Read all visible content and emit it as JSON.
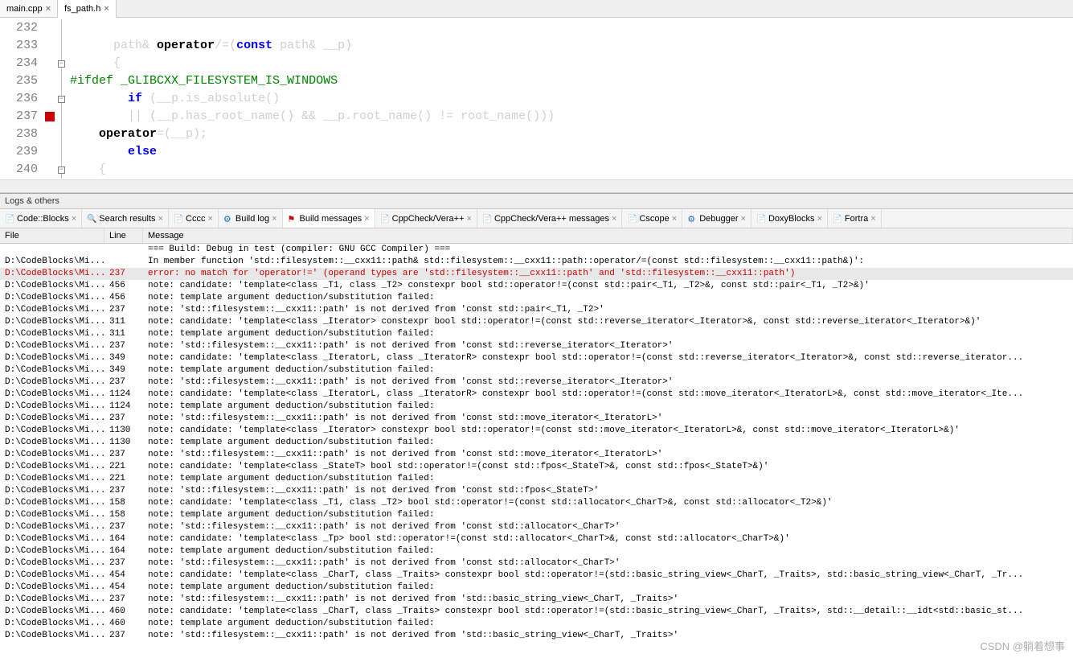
{
  "file_tabs": [
    {
      "label": "main.cpp",
      "active": false
    },
    {
      "label": "fs_path.h",
      "active": true
    }
  ],
  "code": {
    "lines": [
      {
        "n": 232,
        "fold": "line",
        "html": ""
      },
      {
        "n": 233,
        "fold": "line",
        "html": "      <span class='fade'>path&amp; </span><span class='bold'>operator</span><span class='fade'>/=(</span><span class='kw'>const</span><span class='fade'> path&amp; __p)</span>"
      },
      {
        "n": 234,
        "fold": "box-",
        "html": "      <span class='fade'>{</span>"
      },
      {
        "n": 235,
        "fold": "line",
        "html": "<span class='pp'>#ifdef _GLIBCXX_FILESYSTEM_IS_WINDOWS</span>"
      },
      {
        "n": 236,
        "fold": "box-",
        "html": "        <span class='kw'>if</span> <span class='fade'>(__p.is_absolute()</span>"
      },
      {
        "n": 237,
        "fold": "line",
        "mark": "red",
        "html": "        <span class='fade'>|| (__p.has_root_name() &amp;&amp; __p.root_name() != root_name()))</span>"
      },
      {
        "n": 238,
        "fold": "line",
        "html": "    <span class='bold'>operator</span><span class='fade'>=(__p);</span>"
      },
      {
        "n": 239,
        "fold": "line",
        "html": "        <span class='kw'>else</span>"
      },
      {
        "n": 240,
        "fold": "box-",
        "html": "    <span class='fade'>{</span>"
      }
    ]
  },
  "logs_header": "Logs & others",
  "panel_tabs": [
    {
      "icon": "note",
      "label": "Code::Blocks"
    },
    {
      "icon": "mag",
      "label": "Search results"
    },
    {
      "icon": "note",
      "label": "Cccc"
    },
    {
      "icon": "gear",
      "label": "Build log"
    },
    {
      "icon": "flag",
      "label": "Build messages",
      "active": true
    },
    {
      "icon": "note",
      "label": "CppCheck/Vera++"
    },
    {
      "icon": "note",
      "label": "CppCheck/Vera++ messages"
    },
    {
      "icon": "note",
      "label": "Cscope"
    },
    {
      "icon": "gear",
      "label": "Debugger"
    },
    {
      "icon": "note",
      "label": "DoxyBlocks"
    },
    {
      "icon": "note",
      "label": "Fortra"
    }
  ],
  "msg_columns": {
    "file": "File",
    "line": "Line",
    "message": "Message"
  },
  "messages": [
    {
      "file": "",
      "line": "",
      "msg": "=== Build: Debug in test (compiler: GNU GCC Compiler) ==="
    },
    {
      "file": "D:\\CodeBlocks\\Mi...",
      "line": "",
      "msg": "In member function 'std::filesystem::__cxx11::path& std::filesystem::__cxx11::path::operator/=(const std::filesystem::__cxx11::path&)':"
    },
    {
      "file": "D:\\CodeBlocks\\Mi...",
      "line": "237",
      "msg": "error: no match for 'operator!=' (operand types are 'std::filesystem::__cxx11::path' and 'std::filesystem::__cxx11::path')",
      "err": true,
      "sel": true
    },
    {
      "file": "D:\\CodeBlocks\\Mi...",
      "line": "456",
      "msg": "note: candidate: 'template<class _T1, class _T2> constexpr bool std::operator!=(const std::pair<_T1, _T2>&,  const std::pair<_T1, _T2>&)'"
    },
    {
      "file": "D:\\CodeBlocks\\Mi...",
      "line": "456",
      "msg": "note:   template argument deduction/substitution failed:"
    },
    {
      "file": "D:\\CodeBlocks\\Mi...",
      "line": "237",
      "msg": "note:   'std::filesystem::__cxx11::path' is not derived from 'const std::pair<_T1, _T2>'"
    },
    {
      "file": "D:\\CodeBlocks\\Mi...",
      "line": "311",
      "msg": "note: candidate: 'template<class _Iterator> constexpr bool std::operator!=(const std::reverse_iterator<_Iterator>&,  const std::reverse_iterator<_Iterator>&)'"
    },
    {
      "file": "D:\\CodeBlocks\\Mi...",
      "line": "311",
      "msg": "note:   template argument deduction/substitution failed:"
    },
    {
      "file": "D:\\CodeBlocks\\Mi...",
      "line": "237",
      "msg": "note:   'std::filesystem::__cxx11::path' is not derived from 'const std::reverse_iterator<_Iterator>'"
    },
    {
      "file": "D:\\CodeBlocks\\Mi...",
      "line": "349",
      "msg": "note: candidate: 'template<class _IteratorL, class _IteratorR> constexpr bool std::operator!=(const std::reverse_iterator<_Iterator>&,  const std::reverse_iterator..."
    },
    {
      "file": "D:\\CodeBlocks\\Mi...",
      "line": "349",
      "msg": "note:   template argument deduction/substitution failed:"
    },
    {
      "file": "D:\\CodeBlocks\\Mi...",
      "line": "237",
      "msg": "note:   'std::filesystem::__cxx11::path' is not derived from 'const std::reverse_iterator<_Iterator>'"
    },
    {
      "file": "D:\\CodeBlocks\\Mi...",
      "line": "1124",
      "msg": "note: candidate: 'template<class _IteratorL, class _IteratorR> constexpr bool std::operator!=(const std::move_iterator<_IteratorL>&,  const std::move_iterator<_Ite..."
    },
    {
      "file": "D:\\CodeBlocks\\Mi...",
      "line": "1124",
      "msg": "note:   template argument deduction/substitution failed:"
    },
    {
      "file": "D:\\CodeBlocks\\Mi...",
      "line": "237",
      "msg": "note:   'std::filesystem::__cxx11::path' is not derived from 'const std::move_iterator<_IteratorL>'"
    },
    {
      "file": "D:\\CodeBlocks\\Mi...",
      "line": "1130",
      "msg": "note: candidate: 'template<class _Iterator> constexpr bool std::operator!=(const std::move_iterator<_IteratorL>&,  const std::move_iterator<_IteratorL>&)'"
    },
    {
      "file": "D:\\CodeBlocks\\Mi...",
      "line": "1130",
      "msg": "note:   template argument deduction/substitution failed:"
    },
    {
      "file": "D:\\CodeBlocks\\Mi...",
      "line": "237",
      "msg": "note:   'std::filesystem::__cxx11::path' is not derived from 'const std::move_iterator<_IteratorL>'"
    },
    {
      "file": "D:\\CodeBlocks\\Mi...",
      "line": "221",
      "msg": "note: candidate: 'template<class _StateT> bool std::operator!=(const std::fpos<_StateT>&,  const std::fpos<_StateT>&)'"
    },
    {
      "file": "D:\\CodeBlocks\\Mi...",
      "line": "221",
      "msg": "note:   template argument deduction/substitution failed:"
    },
    {
      "file": "D:\\CodeBlocks\\Mi...",
      "line": "237",
      "msg": "note:   'std::filesystem::__cxx11::path' is not derived from 'const std::fpos<_StateT>'"
    },
    {
      "file": "D:\\CodeBlocks\\Mi...",
      "line": "158",
      "msg": "note: candidate: 'template<class _T1, class _T2> bool std::operator!=(const std::allocator<_CharT>&,  const std::allocator<_T2>&)'"
    },
    {
      "file": "D:\\CodeBlocks\\Mi...",
      "line": "158",
      "msg": "note:   template argument deduction/substitution failed:"
    },
    {
      "file": "D:\\CodeBlocks\\Mi...",
      "line": "237",
      "msg": "note:   'std::filesystem::__cxx11::path' is not derived from 'const std::allocator<_CharT>'"
    },
    {
      "file": "D:\\CodeBlocks\\Mi...",
      "line": "164",
      "msg": "note: candidate: 'template<class _Tp> bool std::operator!=(const std::allocator<_CharT>&,  const std::allocator<_CharT>&)'"
    },
    {
      "file": "D:\\CodeBlocks\\Mi...",
      "line": "164",
      "msg": "note:   template argument deduction/substitution failed:"
    },
    {
      "file": "D:\\CodeBlocks\\Mi...",
      "line": "237",
      "msg": "note:   'std::filesystem::__cxx11::path' is not derived from 'const std::allocator<_CharT>'"
    },
    {
      "file": "D:\\CodeBlocks\\Mi...",
      "line": "454",
      "msg": "note: candidate: 'template<class _CharT, class _Traits> constexpr bool std::operator!=(std::basic_string_view<_CharT, _Traits>, std::basic_string_view<_CharT, _Tr..."
    },
    {
      "file": "D:\\CodeBlocks\\Mi...",
      "line": "454",
      "msg": "note:   template argument deduction/substitution failed:"
    },
    {
      "file": "D:\\CodeBlocks\\Mi...",
      "line": "237",
      "msg": "note:   'std::filesystem::__cxx11::path' is not derived from 'std::basic_string_view<_CharT, _Traits>'"
    },
    {
      "file": "D:\\CodeBlocks\\Mi...",
      "line": "460",
      "msg": "note: candidate: 'template<class _CharT, class _Traits> constexpr bool std::operator!=(std::basic_string_view<_CharT, _Traits>, std::__detail::__idt<std::basic_st..."
    },
    {
      "file": "D:\\CodeBlocks\\Mi...",
      "line": "460",
      "msg": "note:   template argument deduction/substitution failed:"
    },
    {
      "file": "D:\\CodeBlocks\\Mi...",
      "line": "237",
      "msg": "note:   'std::filesystem::__cxx11::path' is not derived from 'std::basic_string_view<_CharT, _Traits>'"
    }
  ],
  "watermark": "CSDN @躺着想事"
}
